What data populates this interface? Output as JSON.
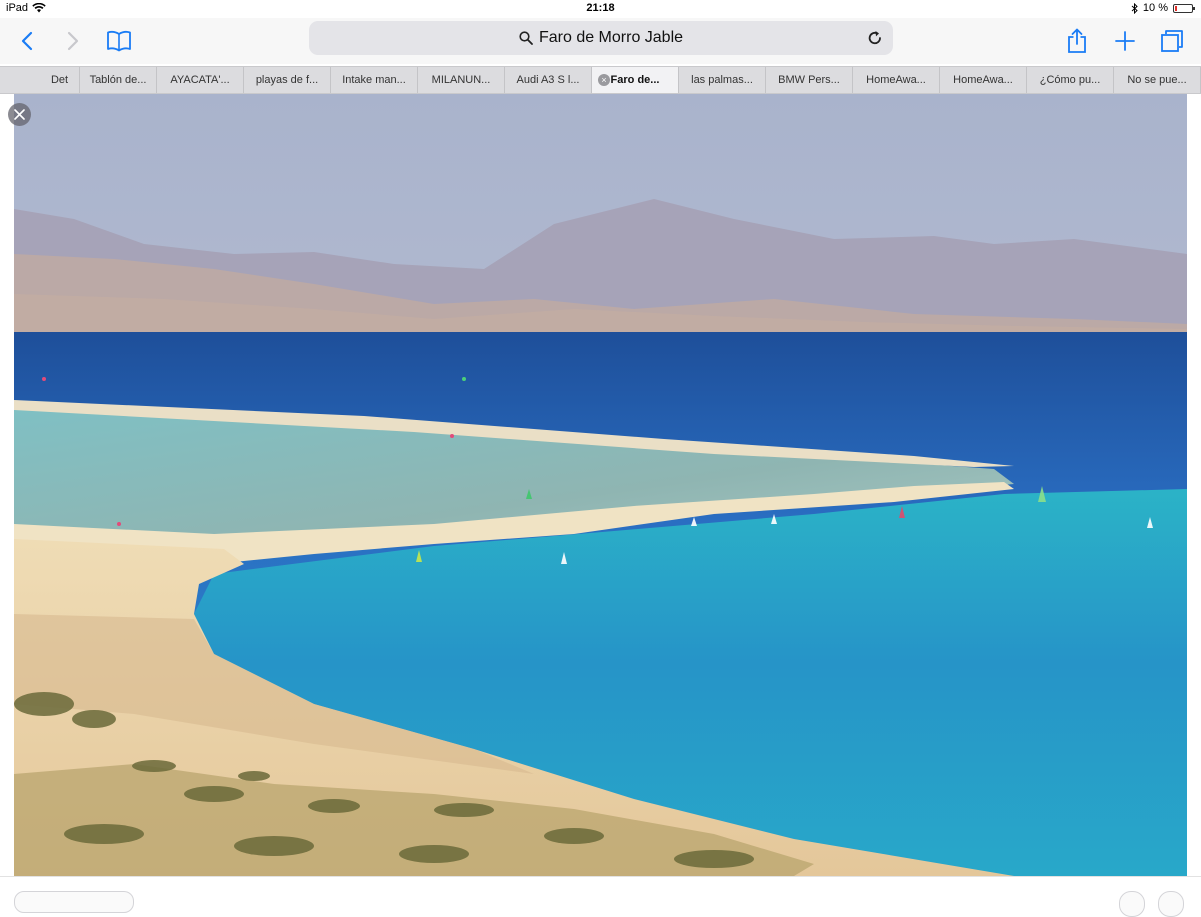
{
  "status": {
    "device": "iPad",
    "time": "21:18",
    "battery": "10 %",
    "battery_level": 0.1
  },
  "toolbar": {
    "address": "Faro de Morro Jable"
  },
  "tabs": [
    {
      "label": "Det"
    },
    {
      "label": "Tablón de..."
    },
    {
      "label": "AYACATA'..."
    },
    {
      "label": "playas de f..."
    },
    {
      "label": "Intake man..."
    },
    {
      "label": "MILANUN..."
    },
    {
      "label": "Audi A3 S l..."
    },
    {
      "label": "Faro de...",
      "active": true
    },
    {
      "label": "las palmas..."
    },
    {
      "label": "BMW Pers..."
    },
    {
      "label": "HomeAwa..."
    },
    {
      "label": "HomeAwa..."
    },
    {
      "label": "¿Cómo pu..."
    },
    {
      "label": "No se pue..."
    }
  ],
  "colors": {
    "accent": "#1a7cf5"
  },
  "icons": {
    "back": "chevron-left-icon",
    "forward": "chevron-right-icon",
    "bookmarks": "book-icon",
    "search": "search-icon",
    "reload": "reload-icon",
    "share": "share-icon",
    "new_tab": "plus-icon",
    "tabs": "tabs-overview-icon",
    "close": "close-icon"
  }
}
